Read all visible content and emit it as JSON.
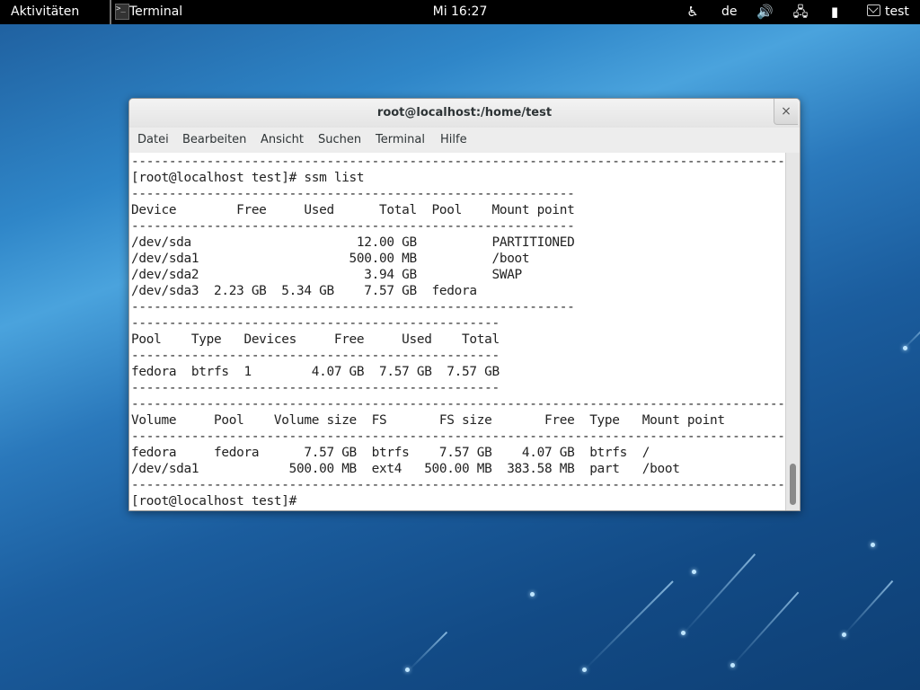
{
  "topbar": {
    "activities": "Aktivitäten",
    "app_menu": "Terminal",
    "clock": "Mi 16:27",
    "language": "de",
    "user": "test",
    "icons": [
      "accessibility-icon",
      "volume-icon",
      "network-icon",
      "battery-icon",
      "mail-icon"
    ]
  },
  "window": {
    "title": "root@localhost:/home/test",
    "close_label": "×",
    "menus": [
      "Datei",
      "Bearbeiten",
      "Ansicht",
      "Suchen",
      "Terminal",
      "Hilfe"
    ]
  },
  "terminal": {
    "lines": [
      "-----------------------------------------------------------------------------------------------",
      "[root@localhost test]# ssm list",
      "-----------------------------------------------------------",
      "Device        Free     Used      Total  Pool    Mount point",
      "-----------------------------------------------------------",
      "/dev/sda                      12.00 GB          PARTITIONED",
      "/dev/sda1                    500.00 MB          /boot",
      "/dev/sda2                      3.94 GB          SWAP",
      "/dev/sda3  2.23 GB  5.34 GB    7.57 GB  fedora",
      "-----------------------------------------------------------",
      "-------------------------------------------------",
      "Pool    Type   Devices     Free     Used    Total",
      "-------------------------------------------------",
      "fedora  btrfs  1        4.07 GB  7.57 GB  7.57 GB",
      "-------------------------------------------------",
      "-----------------------------------------------------------------------------------------------",
      "Volume     Pool    Volume size  FS       FS size       Free  Type   Mount point",
      "-----------------------------------------------------------------------------------------------",
      "fedora     fedora      7.57 GB  btrfs    7.57 GB    4.07 GB  btrfs  /",
      "/dev/sda1            500.00 MB  ext4   500.00 MB  383.58 MB  part   /boot",
      "-----------------------------------------------------------------------------------------------",
      "[root@localhost test]# "
    ]
  }
}
